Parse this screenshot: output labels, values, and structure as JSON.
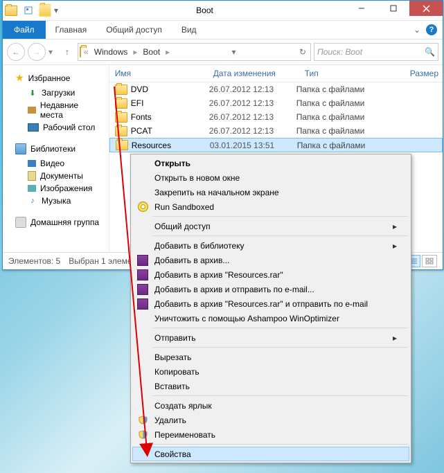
{
  "window": {
    "title": "Boot"
  },
  "ribbon": {
    "file": "Файл",
    "tabs": [
      "Главная",
      "Общий доступ",
      "Вид"
    ]
  },
  "address": {
    "crumbs": [
      "...",
      "Windows",
      "Boot"
    ],
    "search_placeholder": "Поиск: Boot"
  },
  "nav": {
    "favorites": "Избранное",
    "fav_items": [
      "Загрузки",
      "Недавние места",
      "Рабочий стол"
    ],
    "libraries": "Библиотеки",
    "lib_items": [
      "Видео",
      "Документы",
      "Изображения",
      "Музыка"
    ],
    "homegroup": "Домашняя группа"
  },
  "columns": {
    "name": "Имя",
    "date": "Дата изменения",
    "type": "Тип",
    "size": "Размер"
  },
  "rows": [
    {
      "name": "DVD",
      "date": "26.07.2012 12:13",
      "type": "Папка с файлами"
    },
    {
      "name": "EFI",
      "date": "26.07.2012 12:13",
      "type": "Папка с файлами"
    },
    {
      "name": "Fonts",
      "date": "26.07.2012 12:13",
      "type": "Папка с файлами"
    },
    {
      "name": "PCAT",
      "date": "26.07.2012 12:13",
      "type": "Папка с файлами"
    },
    {
      "name": "Resources",
      "date": "03.01.2015 13:51",
      "type": "Папка с файлами",
      "selected": true
    }
  ],
  "status": {
    "count": "Элементов: 5",
    "selection": "Выбран 1 элемент"
  },
  "menu": {
    "items": [
      {
        "label": "Открыть",
        "bold": true
      },
      {
        "label": "Открыть в новом окне"
      },
      {
        "label": "Закрепить на начальном экране"
      },
      {
        "label": "Run Sandboxed",
        "icon": "disc"
      },
      {
        "sep": true
      },
      {
        "label": "Общий доступ",
        "sub": true
      },
      {
        "sep": true
      },
      {
        "label": "Добавить в библиотеку",
        "sub": true
      },
      {
        "label": "Добавить в архив...",
        "icon": "rar"
      },
      {
        "label": "Добавить в архив \"Resources.rar\"",
        "icon": "rar"
      },
      {
        "label": "Добавить в архив и отправить по e-mail...",
        "icon": "rar"
      },
      {
        "label": "Добавить в архив \"Resources.rar\" и отправить по e-mail",
        "icon": "rar"
      },
      {
        "label": "Уничтожить с помощью Ashampoo WinOptimizer"
      },
      {
        "sep": true
      },
      {
        "label": "Отправить",
        "sub": true
      },
      {
        "sep": true
      },
      {
        "label": "Вырезать"
      },
      {
        "label": "Копировать"
      },
      {
        "label": "Вставить"
      },
      {
        "sep": true
      },
      {
        "label": "Создать ярлык"
      },
      {
        "label": "Удалить",
        "icon": "shield"
      },
      {
        "label": "Переименовать",
        "icon": "shield"
      },
      {
        "sep": true
      },
      {
        "label": "Свойства",
        "highlight": true
      }
    ]
  }
}
